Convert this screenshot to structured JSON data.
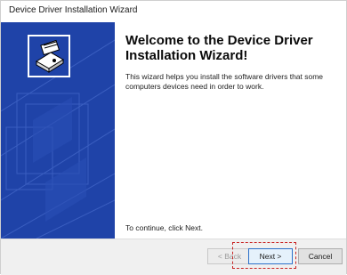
{
  "window": {
    "title": "Device Driver Installation Wizard"
  },
  "banner": {
    "background_color": "#1f43a8",
    "icon": "hardware-device-icon"
  },
  "content": {
    "heading": "Welcome to the Device Driver Installation Wizard!",
    "description": "This wizard helps you install the software drivers that some computers devices need in order to work.",
    "continue_text": "To continue, click Next."
  },
  "buttons": {
    "back_label": "< Back",
    "next_label": "Next >",
    "cancel_label": "Cancel"
  },
  "colors": {
    "accent": "#2c71c9",
    "highlight": "#c82323"
  }
}
